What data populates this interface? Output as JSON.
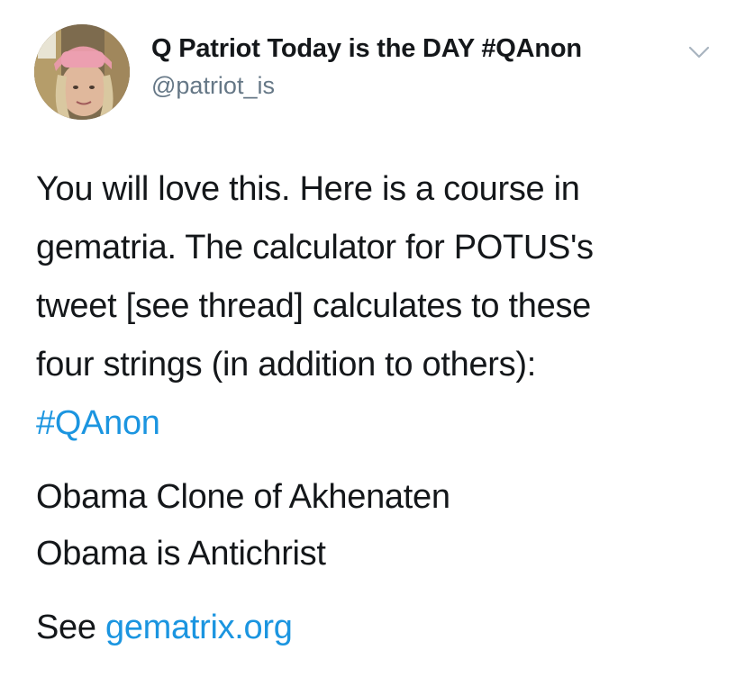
{
  "tweet": {
    "display_name": "Q Patriot Today is the DAY #QAnon",
    "handle": "@patriot_is",
    "body_lines": [
      "You will love this.  Here is a course in",
      "gematria.  The calculator for POTUS's",
      "tweet [see thread] calculates to these",
      "four strings (in addition to others):"
    ],
    "hashtag": "#QAnon",
    "list_lines": [
      "Obama Clone of Akhenaten",
      "Obama is Antichrist"
    ],
    "see_label": "See",
    "link_text": "gematrix.org"
  },
  "icons": {
    "menu": "chevron-down-icon",
    "avatar": "avatar-photo"
  },
  "colors": {
    "link": "#1b95e0",
    "text": "#14171a",
    "secondary": "#657786"
  }
}
